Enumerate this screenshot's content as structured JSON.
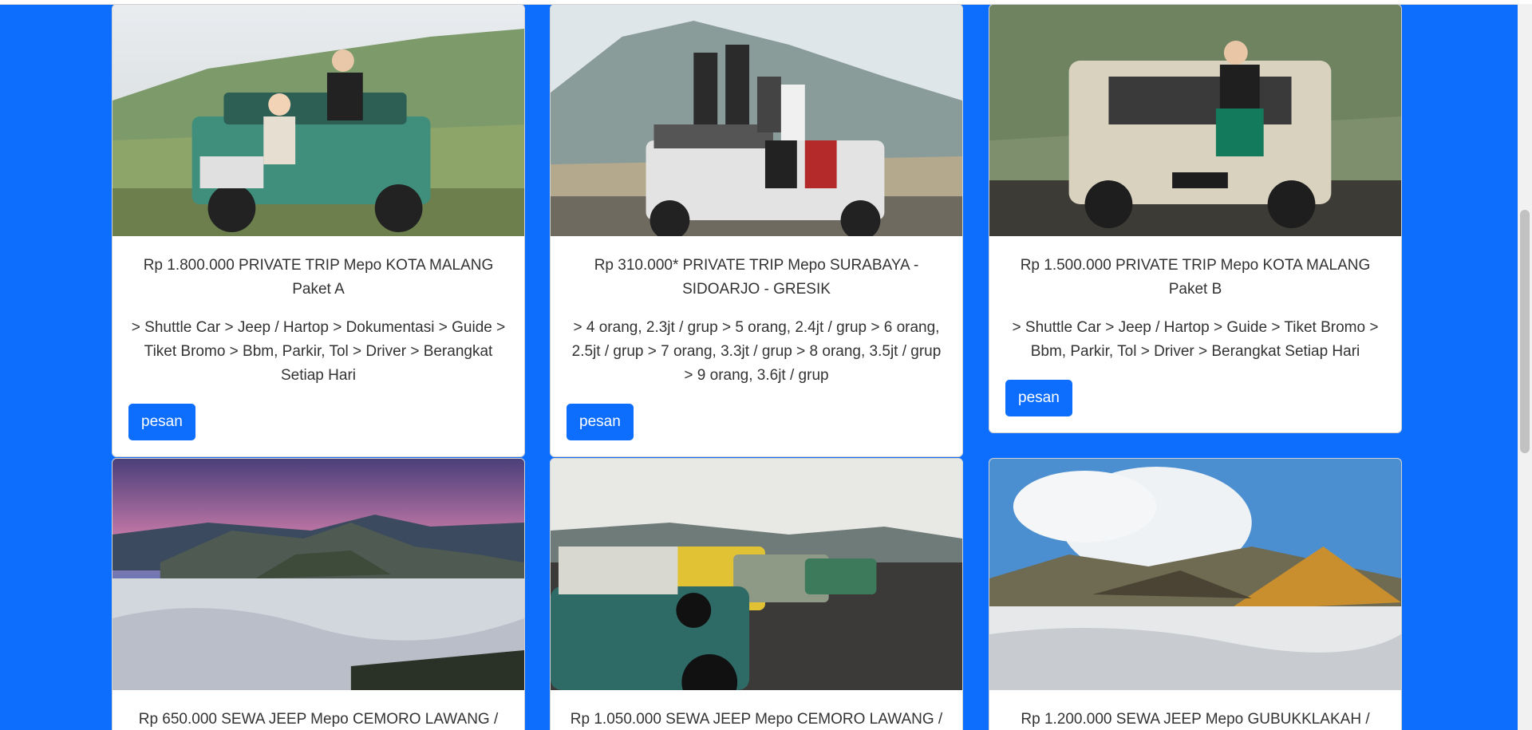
{
  "colors": {
    "page_bg": "#0d6efd",
    "button_bg": "#0d6efd",
    "button_text": "#ffffff",
    "card_bg": "#ffffff",
    "text": "#333333"
  },
  "packages": [
    {
      "title": "Rp 1.800.000 PRIVATE TRIP Mepo KOTA MALANG Paket A",
      "description": "> Shuttle Car > Jeep / Hartop > Dokumentasi > Guide > Tiket Bromo > Bbm, Parkir, Tol > Driver > Berangkat Setiap Hari",
      "button_label": "pesan",
      "image": "jeep-tourists-photo"
    },
    {
      "title": "Rp 310.000* PRIVATE TRIP Mepo SURABAYA - SIDOARJO - GRESIK",
      "description": "> 4 orang, 2.3jt / grup > 5 orang, 2.4jt / grup > 6 orang, 2.5jt / grup > 7 orang, 3.3jt / grup > 8 orang, 3.5jt / grup > 9 orang, 3.6jt / grup",
      "button_label": "pesan",
      "image": "group-on-jeep-photo"
    },
    {
      "title": "Rp 1.500.000 PRIVATE TRIP Mepo KOTA MALANG Paket B",
      "description": "> Shuttle Car > Jeep / Hartop > Guide > Tiket Bromo > Bbm, Parkir, Tol > Driver > Berangkat Setiap Hari",
      "button_label": "pesan",
      "image": "woman-on-jeep-photo"
    },
    {
      "title": "Rp 650.000 SEWA JEEP Mepo CEMORO LAWANG /",
      "image": "bromo-sunrise-photo"
    },
    {
      "title": "Rp 1.050.000 SEWA JEEP Mepo CEMORO LAWANG /",
      "image": "jeep-row-photo"
    },
    {
      "title": "Rp 1.200.000 SEWA JEEP Mepo GUBUKKLAKAH /",
      "image": "volcano-smoke-photo"
    }
  ]
}
